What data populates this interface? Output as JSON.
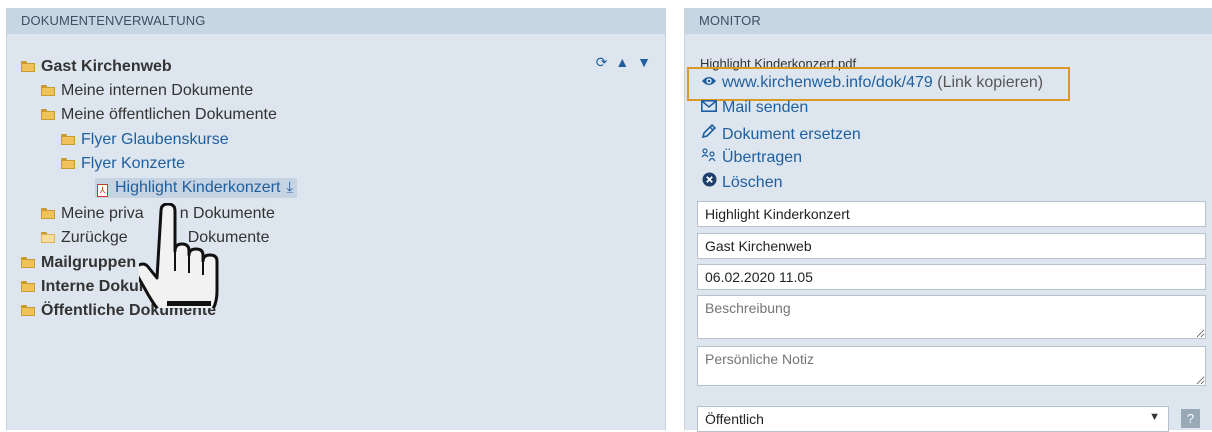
{
  "left_panel": {
    "title": "DOKUMENTENVERWALTUNG"
  },
  "tree": {
    "root": "Gast Kirchenweb",
    "internal": "Meine internen Dokumente",
    "public": "Meine öffentlichen Dokumente",
    "flyer_glauben": "Flyer Glaubenskurse",
    "flyer_konzerte": "Flyer Konzerte",
    "selected_file": "Highlight Kinderkonzert",
    "private_partial": "Meine priva",
    "private_rest": "n Dokumente",
    "returned_partial": "Zurückge",
    "returned_rest": "Dokumente",
    "mailgroups": "Mailgruppen",
    "internal_docs": "Interne Dokum",
    "public_docs": "Öffentliche Dokumente"
  },
  "right_panel": {
    "title": "MONITOR"
  },
  "monitor": {
    "filename": "Highlight Kinderkonzert.pdf",
    "link": "www.kirchenweb.info/dok/479",
    "copy_link": "(Link kopieren)",
    "mail": "Mail senden",
    "replace": "Dokument ersetzen",
    "transfer": "Übertragen",
    "delete": "Löschen",
    "title_value": "Highlight Kinderkonzert",
    "owner_value": "Gast Kirchenweb",
    "date_value": "06.02.2020 11.05",
    "description_placeholder": "Beschreibung",
    "note_placeholder": "Persönliche Notiz",
    "visibility": "Öffentlich",
    "help": "?"
  },
  "colors": {
    "panel_bg": "#dde6ee",
    "header_bg": "#c8d6e3",
    "link": "#1f5f9f",
    "highlight_border": "#d99a25"
  }
}
